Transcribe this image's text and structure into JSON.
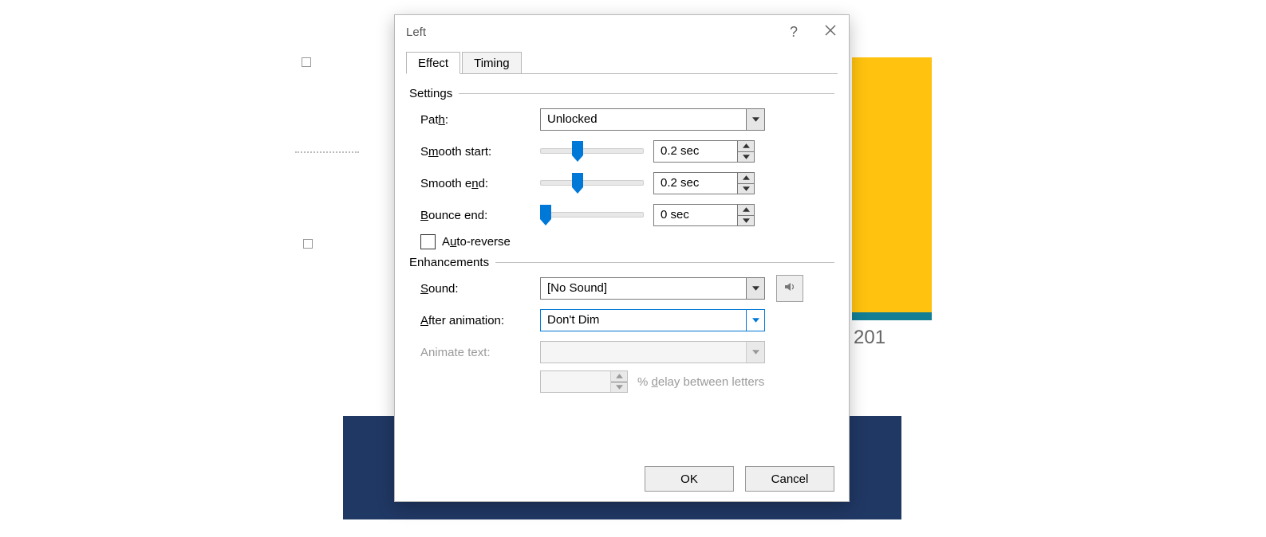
{
  "dialog": {
    "title": "Left",
    "tabs": {
      "effect": "Effect",
      "timing": "Timing"
    },
    "groups": {
      "settings": "Settings",
      "enhancements": "Enhancements"
    },
    "labels": {
      "path_pre": "Pat",
      "path_u": "h",
      "path_post": ":",
      "smoothstart_pre": "S",
      "smoothstart_u": "m",
      "smoothstart_post": "ooth start:",
      "smoothend_pre": "Smooth e",
      "smoothend_u": "n",
      "smoothend_post": "d:",
      "bounce_u": "B",
      "bounce_post": "ounce end:",
      "autorev_pre": "A",
      "autorev_u": "u",
      "autorev_post": "to-reverse",
      "sound_u": "S",
      "sound_post": "ound:",
      "afteranim_u": "A",
      "afteranim_post": "fter animation:",
      "animtext": "Animate text:",
      "delay_pre": "% ",
      "delay_u": "d",
      "delay_post": "elay between letters"
    },
    "values": {
      "path": "Unlocked",
      "smooth_start": "0.2 sec",
      "smooth_end": "0.2 sec",
      "bounce_end": "0 sec",
      "sound": "[No Sound]",
      "after_animation": "Don't Dim"
    },
    "sliders": {
      "smooth_start_pct": 36,
      "smooth_end_pct": 36,
      "bounce_end_pct": 5
    },
    "buttons": {
      "ok": "OK",
      "cancel": "Cancel"
    }
  },
  "background": {
    "year": "201"
  }
}
